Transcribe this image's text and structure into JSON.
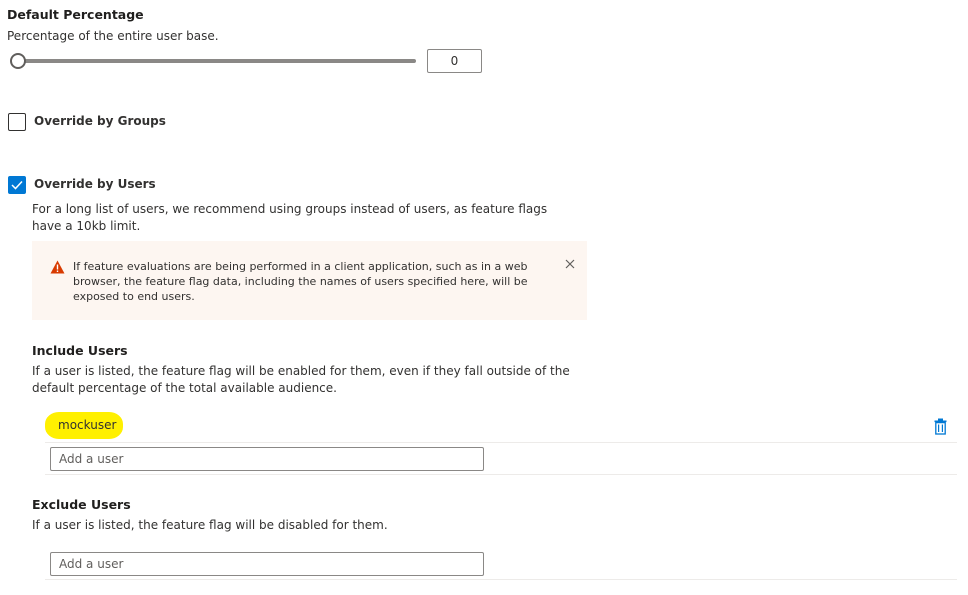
{
  "default_percentage": {
    "title": "Default Percentage",
    "description": "Percentage of the entire user base.",
    "value": "0",
    "slider_fraction": 0
  },
  "override_groups": {
    "label": "Override by Groups",
    "checked": false
  },
  "override_users": {
    "label": "Override by Users",
    "checked": true,
    "description": "For a long list of users, we recommend using groups instead of users, as feature flags have a 10kb limit."
  },
  "warning": {
    "text": "If feature evaluations are being performed in a client application, such as in a web browser, the feature flag data, including the names of users specified here, will be exposed to end users.",
    "icon": "warning-triangle-icon",
    "close_icon": "close-icon",
    "color": "#d83b01"
  },
  "include_users": {
    "title": "Include Users",
    "description": "If a user is listed, the feature flag will be enabled for them, even if they fall outside of the default percentage of the total available audience.",
    "users": [
      "mockuser"
    ],
    "placeholder": "Add a user",
    "delete_icon": "trash-icon"
  },
  "exclude_users": {
    "title": "Exclude Users",
    "description": "If a user is listed, the feature flag will be disabled for them.",
    "placeholder": "Add a user"
  },
  "colors": {
    "accent": "#0078d4",
    "highlight": "#fff000",
    "banner_bg": "#fdf6f1"
  }
}
